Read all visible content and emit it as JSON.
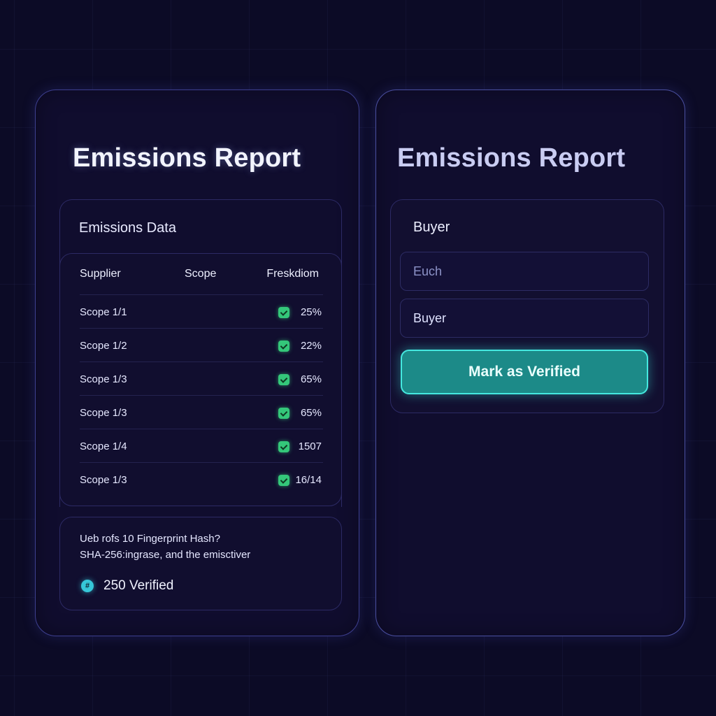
{
  "left_panel": {
    "title": "Emissions Report",
    "data_card_title": "Emissions Data",
    "table": {
      "headers": [
        "Supplier",
        "Scope",
        "Freskdiom"
      ],
      "rows": [
        {
          "name": "Scope 1/1",
          "value": "25%"
        },
        {
          "name": "Scope 1/2",
          "value": "22%"
        },
        {
          "name": "Scope 1/3",
          "value": "65%"
        },
        {
          "name": "Scope 1/3",
          "value": "65%"
        },
        {
          "name": "Scope 1/4",
          "value": "1507"
        },
        {
          "name": "Scope 1/3",
          "value": "16/14"
        }
      ]
    },
    "hash": {
      "line1": "Ueb rofs 10 Fingerprint Hash?",
      "line2": "SHA-256:ingrase, and the emisctiver",
      "verified_icon": "hash-icon",
      "verified_label": "250 Verified"
    }
  },
  "right_panel": {
    "title": "Emissions Report",
    "buyer_title": "Buyer",
    "field_1_value": "Euch",
    "field_2_value": "Buyer",
    "verify_button": "Mark as Verified"
  },
  "colors": {
    "background": "#0c0b26",
    "panel": "#100d2e",
    "accent_teal": "#45e8df",
    "check_green": "#34c77a",
    "verified_cyan": "#36c7d8"
  }
}
